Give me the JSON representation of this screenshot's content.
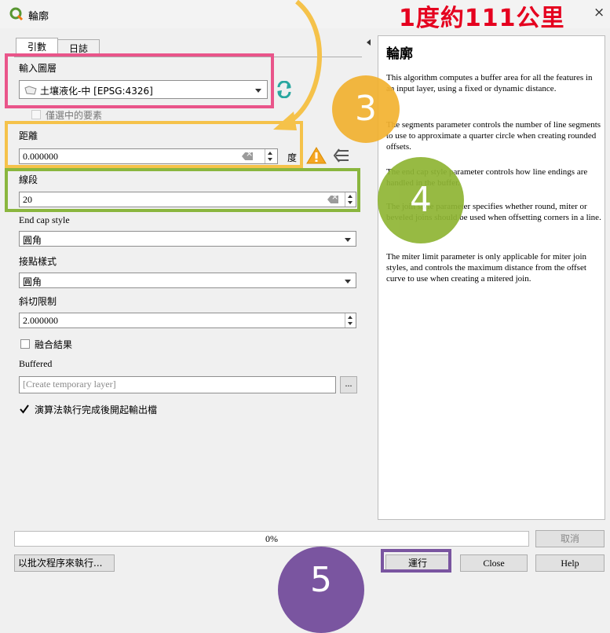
{
  "window": {
    "title": "輪廓",
    "annotation_text": "1度約111公里",
    "close_glyph": "×"
  },
  "tabs": [
    {
      "label": "引數"
    },
    {
      "label": "日誌"
    }
  ],
  "params": {
    "input_layer_label": "輸入圖層",
    "input_layer_value": "土壤液化-中 [EPSG:4326]",
    "selected_only_label": "僅選中的要素",
    "distance_label": "距離",
    "distance_value": "0.000000",
    "distance_unit": "度",
    "segments_label": "線段",
    "segments_value": "20",
    "endcap_label": "End cap style",
    "endcap_value": "圓角",
    "join_label": "接點樣式",
    "join_value": "圓角",
    "miter_label": "斜切限制",
    "miter_value": "2.000000",
    "dissolve_label": "融合結果",
    "buffered_label": "Buffered",
    "buffered_placeholder": "[Create temporary layer]",
    "browse_label": "...",
    "open_output_label": "演算法執行完成後開起輸出檔"
  },
  "help": {
    "title": "輪廓",
    "p1": "This algorithm computes a buffer area for all the features in an input layer, using a fixed or dynamic distance.",
    "p2": "The segments parameter controls the number of line segments to use to approximate a quarter circle when creating rounded offsets.",
    "p3": "The end cap style parameter controls how line endings are handled in the buffer.",
    "p4": "The join style parameter specifies whether round, miter or beveled joins should be used when offsetting corners in a line.",
    "p5": "The miter limit parameter is only applicable for miter join styles, and controls the maximum distance from the offset curve to use when creating a mitered join."
  },
  "footer": {
    "progress_text": "0%",
    "progress": 0,
    "cancel_label": "取消",
    "batch_label": "以批次程序來執行...",
    "run_label": "運行",
    "close_label": "Close",
    "help_label": "Help"
  },
  "annotations": {
    "step3": "3",
    "step4": "4",
    "step5": "5"
  },
  "colors": {
    "pink": "#e9558a",
    "orange": "#f5c24a",
    "green": "#8ab63e",
    "purple": "#7a55a0",
    "red": "#e5001f",
    "circle_orange": "#f2b230",
    "circle_green": "#8fb534"
  },
  "icons": {
    "app": "qgis-logo-icon",
    "sync": "refresh-icon",
    "warning": "warning-icon",
    "expression": "data-defined-icon"
  }
}
